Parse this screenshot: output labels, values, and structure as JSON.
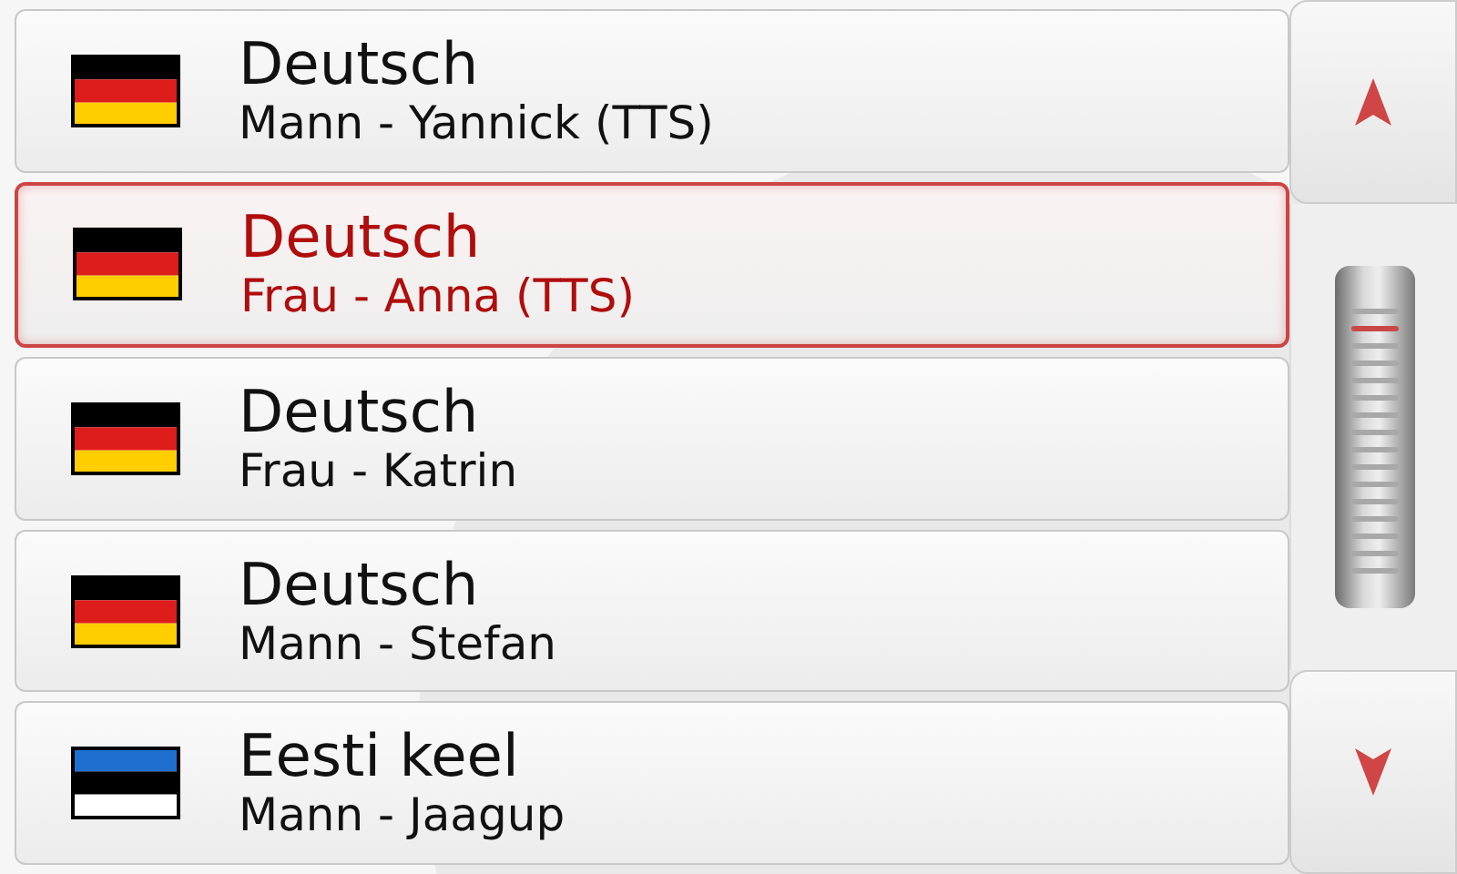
{
  "voices": [
    {
      "language": "Deutsch",
      "voice": "Mann - Yannick (TTS)",
      "kind": "de",
      "selected": false
    },
    {
      "language": "Deutsch",
      "voice": "Frau - Anna (TTS)",
      "kind": "de",
      "selected": true
    },
    {
      "language": "Deutsch",
      "voice": "Frau - Katrin",
      "kind": "de",
      "selected": false
    },
    {
      "language": "Deutsch",
      "voice": "Mann - Stefan",
      "kind": "de",
      "selected": false
    },
    {
      "language": "Eesti keel",
      "voice": "Mann - Jaagup",
      "kind": "ee",
      "selected": false
    }
  ]
}
